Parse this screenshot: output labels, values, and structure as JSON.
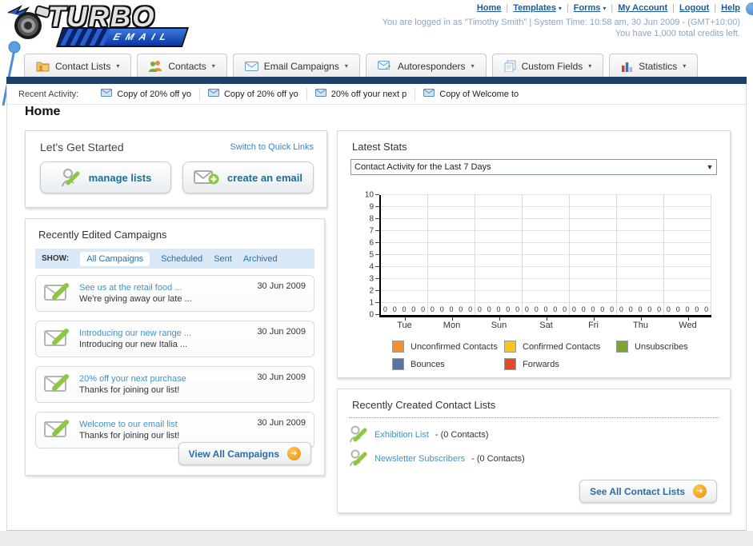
{
  "header": {
    "logo": {
      "title": "TURBO",
      "subtitle": "EMAIL"
    },
    "nav": [
      {
        "label": "Home",
        "dropdown": false
      },
      {
        "label": "Templates",
        "dropdown": true
      },
      {
        "label": "Forms",
        "dropdown": true
      },
      {
        "label": "My Account",
        "dropdown": false
      },
      {
        "label": "Logout",
        "dropdown": false
      },
      {
        "label": "Help",
        "dropdown": false
      }
    ],
    "login_line": "You are logged in as \"Timothy Smith\" | System Time: 10:58 am, 30 Jun 2009 - (GMT+10:00)",
    "credits_line": "You have 1,000 total credits left."
  },
  "tabs": [
    {
      "label": "Contact Lists",
      "icon": "folder"
    },
    {
      "label": "Contacts",
      "icon": "people"
    },
    {
      "label": "Email Campaigns",
      "icon": "envelope"
    },
    {
      "label": "Autoresponders",
      "icon": "autoresponder"
    },
    {
      "label": "Custom Fields",
      "icon": "pages"
    },
    {
      "label": "Statistics",
      "icon": "barchart"
    }
  ],
  "recent_activity": {
    "label": "Recent Activity:",
    "items": [
      "Copy of 20% off yo",
      "Copy of 20% off yo",
      "20% off your next p",
      "Copy of Welcome to"
    ]
  },
  "page_title": "Home",
  "get_started": {
    "title": "Let's Get Started",
    "switch_link": "Switch to Quick Links",
    "buttons": [
      {
        "label": "manage lists"
      },
      {
        "label": "create an email"
      }
    ]
  },
  "campaigns": {
    "title": "Recently Edited Campaigns",
    "show_label": "SHOW:",
    "filters": [
      "All Campaigns",
      "Scheduled",
      "Sent",
      "Archived"
    ],
    "active_filter": "All Campaigns",
    "items": [
      {
        "title": "See us at the retail food ...",
        "subtitle": "We're giving away our late ...",
        "date": "30 Jun 2009"
      },
      {
        "title": "Introducing our new range ...",
        "subtitle": "Introducing our new Italia ...",
        "date": "30 Jun 2009"
      },
      {
        "title": "20% off your next purchase",
        "subtitle": "Thanks for joining our list!",
        "date": "30 Jun 2009"
      },
      {
        "title": "Welcome to our email list",
        "subtitle": "Thanks for joining our list!",
        "date": "30 Jun 2009"
      }
    ],
    "view_all_label": "View All Campaigns"
  },
  "stats": {
    "title": "Latest Stats",
    "dropdown_value": "Contact Activity for the Last 7 Days",
    "chart_data": {
      "type": "bar",
      "title": "Contact Activity for the Last 7 Days",
      "categories": [
        "Tue",
        "Mon",
        "Sun",
        "Sat",
        "Fri",
        "Thu",
        "Wed"
      ],
      "series": [
        {
          "name": "Unconfirmed Contacts",
          "color": "#f78f28",
          "values": [
            0,
            0,
            0,
            0,
            0,
            0,
            0
          ]
        },
        {
          "name": "Confirmed Contacts",
          "color": "#f7c61e",
          "values": [
            0,
            0,
            0,
            0,
            0,
            0,
            0
          ]
        },
        {
          "name": "Unsubscribes",
          "color": "#7ba52c",
          "values": [
            0,
            0,
            0,
            0,
            0,
            0,
            0
          ]
        },
        {
          "name": "Bounces",
          "color": "#5774a9",
          "values": [
            0,
            0,
            0,
            0,
            0,
            0,
            0
          ]
        },
        {
          "name": "Forwards",
          "color": "#e14b28",
          "values": [
            0,
            0,
            0,
            0,
            0,
            0,
            0
          ]
        }
      ],
      "xlabel": "",
      "ylabel": "",
      "ylim": [
        0,
        10
      ],
      "yticks": [
        0,
        1,
        2,
        3,
        4,
        5,
        6,
        7,
        8,
        9,
        10
      ],
      "grid": true,
      "legend_position": "bottom"
    }
  },
  "contact_lists": {
    "title": "Recently Created Contact Lists",
    "items": [
      {
        "name": "Exhibition List",
        "detail": "- (0 Contacts)"
      },
      {
        "name": "Newsletter Subscribers",
        "detail": "- (0 Contacts)"
      }
    ],
    "see_all_label": "See All Contact Lists"
  }
}
